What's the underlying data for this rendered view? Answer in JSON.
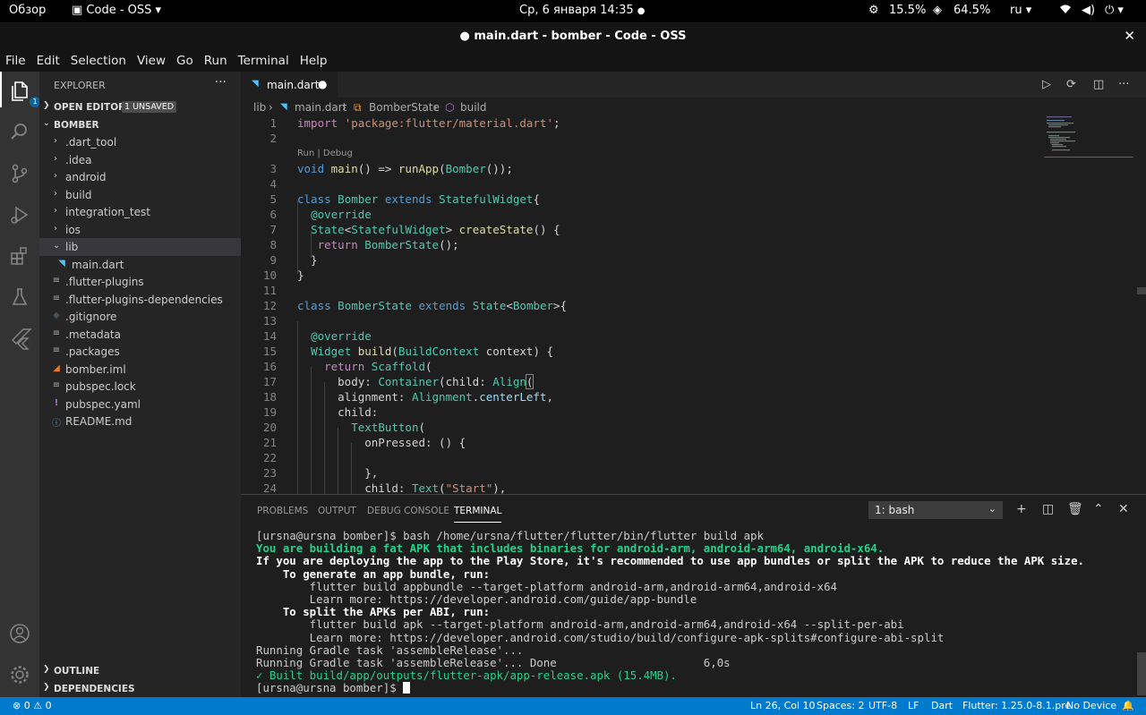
{
  "system_bar": {
    "overview": "Обзор",
    "app_menu": "Code - OSS",
    "clock": "Ср, 6 января  14:35",
    "cpu": "15.5%",
    "memory": "64.5%",
    "lang": "ru"
  },
  "window": {
    "title": "● main.dart - bomber - Code - OSS"
  },
  "menu": [
    "File",
    "Edit",
    "Selection",
    "View",
    "Go",
    "Run",
    "Terminal",
    "Help"
  ],
  "activity_bar": {
    "explorer_badge": "1"
  },
  "sidebar": {
    "title": "EXPLORER",
    "more": "···",
    "open_editors": "OPEN EDITORS",
    "unsaved_badge": "1 UNSAVED",
    "project": "BOMBER",
    "outline": "OUTLINE",
    "dependencies": "DEPENDENCIES",
    "tree": [
      {
        "name": ".dart_tool",
        "kind": "folder"
      },
      {
        "name": ".idea",
        "kind": "folder"
      },
      {
        "name": "android",
        "kind": "folder"
      },
      {
        "name": "build",
        "kind": "folder"
      },
      {
        "name": "integration_test",
        "kind": "folder"
      },
      {
        "name": "ios",
        "kind": "folder"
      },
      {
        "name": "lib",
        "kind": "folder-open"
      },
      {
        "name": "main.dart",
        "kind": "dart"
      },
      {
        "name": ".flutter-plugins",
        "kind": "file"
      },
      {
        "name": ".flutter-plugins-dependencies",
        "kind": "file"
      },
      {
        "name": ".gitignore",
        "kind": "git"
      },
      {
        "name": ".metadata",
        "kind": "file"
      },
      {
        "name": ".packages",
        "kind": "file"
      },
      {
        "name": "bomber.iml",
        "kind": "rss"
      },
      {
        "name": "pubspec.lock",
        "kind": "file"
      },
      {
        "name": "pubspec.yaml",
        "kind": "yaml"
      },
      {
        "name": "README.md",
        "kind": "info"
      }
    ]
  },
  "editor": {
    "tab": {
      "label": "main.dart",
      "dirty": "●"
    },
    "breadcrumb": [
      "lib",
      "main.dart",
      "BomberState",
      "build"
    ],
    "codelens": "Run | Debug",
    "line_numbers": [
      "1",
      "2",
      "3",
      "4",
      "5",
      "6",
      "7",
      "8",
      "9",
      "10",
      "11",
      "12",
      "13",
      "14",
      "15",
      "16",
      "17",
      "18",
      "19",
      "20",
      "21",
      "22",
      "23",
      "24"
    ]
  },
  "panel": {
    "tabs": [
      "PROBLEMS",
      "OUTPUT",
      "DEBUG CONSOLE",
      "TERMINAL"
    ],
    "active_tab": "TERMINAL",
    "terminal_select": "1: bash",
    "terminal_lines": [
      {
        "text": "[ursna@ursna bomber]$ bash /home/ursna/flutter/flutter/bin/flutter build apk",
        "style": "n"
      },
      {
        "text": "You are building a fat APK that includes binaries for android-arm, android-arm64, android-x64.",
        "style": "g"
      },
      {
        "text": "If you are deploying the app to the Play Store, it's recommended to use app bundles or split the APK to reduce the APK size.",
        "style": "b"
      },
      {
        "text": "    To generate an app bundle, run:",
        "style": "b"
      },
      {
        "text": "        flutter build appbundle --target-platform android-arm,android-arm64,android-x64",
        "style": "n"
      },
      {
        "text": "        Learn more: https://developer.android.com/guide/app-bundle",
        "style": "n"
      },
      {
        "text": "    To split the APKs per ABI, run:",
        "style": "b"
      },
      {
        "text": "        flutter build apk --target-platform android-arm,android-arm64,android-x64 --split-per-abi",
        "style": "n"
      },
      {
        "text": "        Learn more: https://developer.android.com/studio/build/configure-apk-splits#configure-abi-split",
        "style": "n"
      },
      {
        "text": "Running Gradle task 'assembleRelease'...",
        "style": "n"
      },
      {
        "text": "Running Gradle task 'assembleRelease'... Done                      6,0s",
        "style": "n"
      },
      {
        "text": "✓ Built build/app/outputs/flutter-apk/app-release.apk (15.4MB).",
        "style": "g"
      },
      {
        "text": "[ursna@ursna bomber]$ ",
        "style": "n"
      }
    ]
  },
  "status_bar": {
    "problems": "⊗ 0 ⚠ 0",
    "position": "Ln 26, Col 10",
    "spaces": "Spaces: 2",
    "encoding": "UTF-8",
    "eol": "LF",
    "language": "Dart",
    "flutter": "Flutter: 1.25.0-8.1.pre",
    "device": "No Device"
  }
}
